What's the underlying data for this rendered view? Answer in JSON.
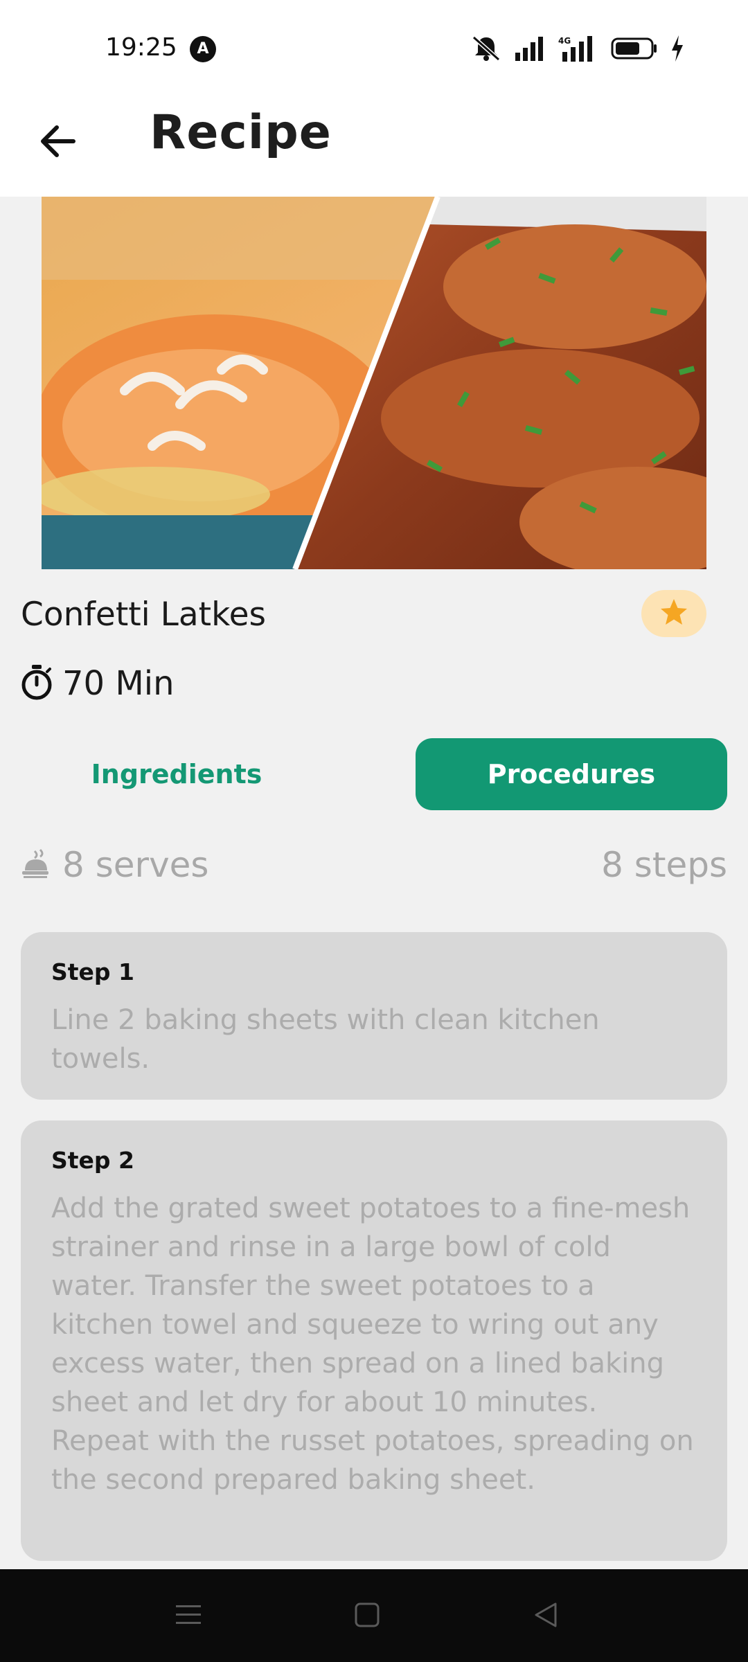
{
  "status_bar": {
    "time": "19:25",
    "app_icon": "A",
    "icons": [
      "mute-bell-icon",
      "signal-icon",
      "4g-signal-icon",
      "battery-icon",
      "charging-icon"
    ]
  },
  "app_bar": {
    "back_icon": "arrow-left-icon",
    "title": "Recipe"
  },
  "recipe": {
    "name": "Confetti Latkes",
    "favorite_icon": "star-icon",
    "timer_icon": "stopwatch-icon",
    "time": "70 Min"
  },
  "tabs": {
    "items": [
      {
        "label": "Ingredients",
        "selected": false
      },
      {
        "label": "Procedures",
        "selected": true
      }
    ],
    "accent_color": "#129873"
  },
  "meta": {
    "serves_icon": "serving-dish-icon",
    "serves": "8 serves",
    "steps": "8 steps"
  },
  "steps": [
    {
      "title": "Step 1",
      "text": "Line 2 baking sheets with clean kitchen towels."
    },
    {
      "title": "Step 2",
      "text": "Add the grated sweet potatoes to a fine-mesh strainer and rinse in a large bowl of cold water. Transfer the sweet potatoes to a kitchen towel and squeeze to wring out any excess water, then spread on a lined baking sheet and let dry for about 10 minutes. Repeat with the russet potatoes, spreading on the second prepared baking sheet."
    }
  ],
  "nav_bar": {
    "icons": [
      "menu-icon",
      "home-square-icon",
      "back-triangle-icon"
    ]
  }
}
